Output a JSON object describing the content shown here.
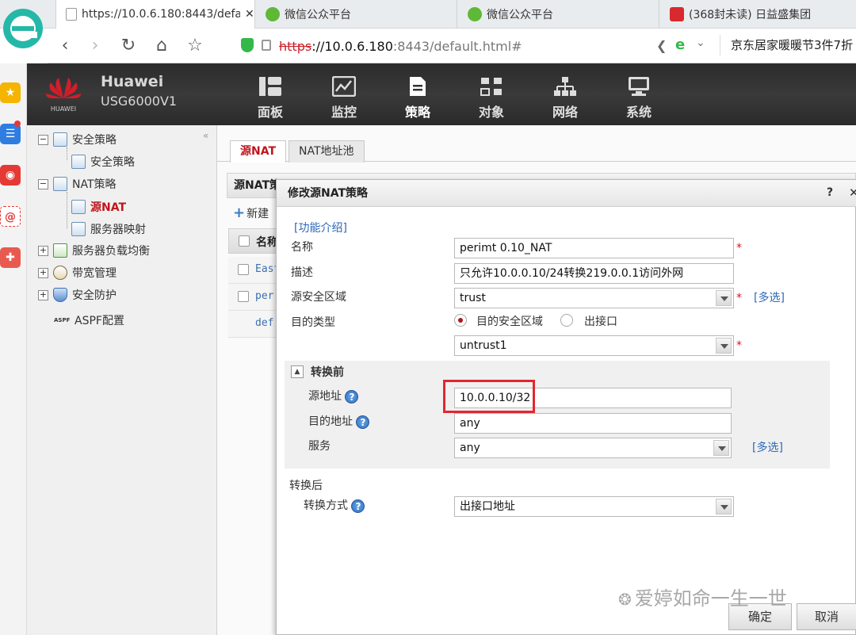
{
  "browser": {
    "tabs": [
      {
        "label": "https://10.0.6.180:8443/defa",
        "active": true
      },
      {
        "label": "微信公众平台",
        "active": false
      },
      {
        "label": "微信公众平台",
        "active": false
      },
      {
        "label": "(368封未读) 日益盛集团",
        "active": false
      }
    ],
    "tab_close": "✕",
    "address": {
      "scheme": "https",
      "host": "://10.0.6.180",
      "rest": ":8443/default.html#"
    },
    "side_link": "京东居家暖暖节3件7折"
  },
  "app": {
    "brand": "Huawei",
    "model": "USG6000V1",
    "logo_text": "HUAWEI",
    "nav": [
      {
        "label": "面板",
        "icon": "dashboard-icon"
      },
      {
        "label": "监控",
        "icon": "monitor-icon"
      },
      {
        "label": "策略",
        "icon": "policy-icon",
        "active": true
      },
      {
        "label": "对象",
        "icon": "object-icon"
      },
      {
        "label": "网络",
        "icon": "network-icon"
      },
      {
        "label": "系统",
        "icon": "system-icon"
      }
    ]
  },
  "tree": {
    "items": [
      {
        "label": "安全策略"
      },
      {
        "label": "安全策略"
      },
      {
        "label": "NAT策略"
      },
      {
        "label": "源NAT"
      },
      {
        "label": "服务器映射"
      },
      {
        "label": "服务器负载均衡"
      },
      {
        "label": "带宽管理"
      },
      {
        "label": "安全防护"
      },
      {
        "label": "ASPF配置"
      }
    ],
    "aspf_icon_text": "ASPF"
  },
  "content": {
    "tabs": [
      "源NAT",
      "NAT地址池"
    ],
    "panel_title": "源NAT策",
    "new_label": "新建",
    "grid_header": "名称",
    "rows": [
      "East",
      "per",
      "def"
    ]
  },
  "dialog": {
    "title": "修改源NAT策略",
    "help": "?",
    "close": "✕",
    "intro_link": "[功能介绍]",
    "name_label": "名称",
    "name_value": "perimt 0.10_NAT",
    "desc_label": "描述",
    "desc_value": "只允许10.0.0.10/24转换219.0.0.1访问外网",
    "src_zone_label": "源安全区域",
    "src_zone_value": "trust",
    "multi_label": "[多选]",
    "dst_type_label": "目的类型",
    "dst_type_options": [
      "目的安全区域",
      "出接口"
    ],
    "dst_zone_value": "untrust1",
    "before_label": "转换前",
    "src_addr_label": "源地址",
    "src_addr_value": "10.0.0.10/32",
    "dst_addr_label": "目的地址",
    "dst_addr_value": "any",
    "service_label": "服务",
    "service_value": "any",
    "after_label": "转换后",
    "method_label": "转换方式",
    "method_value": "出接口地址",
    "ok": "确定",
    "cancel": "取消",
    "required_mark": "*"
  },
  "watermark": "爱婷如命一生一世"
}
